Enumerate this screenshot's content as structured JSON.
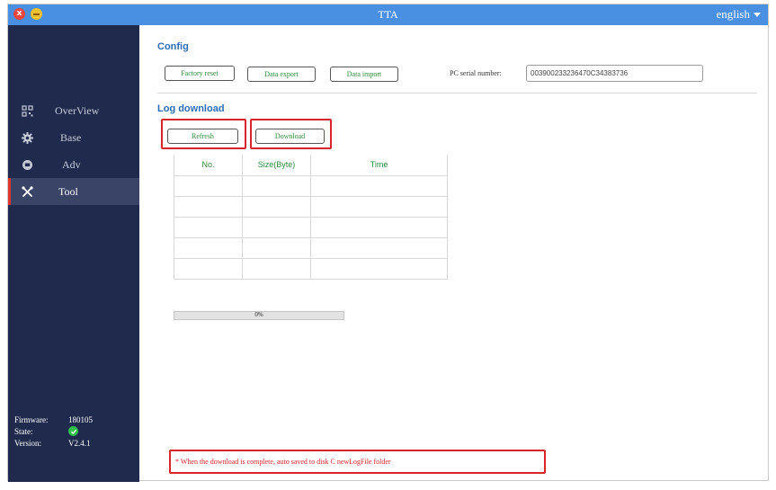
{
  "titlebar": {
    "close_symbol": "x",
    "title": "TTA",
    "language": "english"
  },
  "sidebar": {
    "items": [
      {
        "label": "OverView",
        "icon": "qr-grid-icon",
        "active": false
      },
      {
        "label": "Base",
        "icon": "gear-icon",
        "active": false
      },
      {
        "label": "Adv",
        "icon": "chip-icon",
        "active": false
      },
      {
        "label": "Tool",
        "icon": "tools-icon",
        "active": true
      }
    ],
    "info": {
      "firmware_label": "Firmware:",
      "firmware_value": "180105",
      "state_label": "State:",
      "version_label": "Version:",
      "version_value": "V2.4.1"
    }
  },
  "config": {
    "title": "Config",
    "factory_reset": "Factory reset",
    "data_export": "Data export",
    "data_import": "Data import",
    "serial_label": "PC serial number:",
    "serial_value": "003900233236470C34383736"
  },
  "log_download": {
    "title": "Log download",
    "refresh": "Refresh",
    "download": "Download",
    "columns": [
      "No.",
      "Size(Byte)",
      "Time"
    ],
    "progress_text": "0%",
    "progress_value": 0,
    "note": "* When the download is complete, auto saved to disk C newLogFile folder"
  },
  "colors": {
    "titlebar": "#4a90e2",
    "sidebar": "#1f2a4d",
    "active_item": "#394467",
    "accent_red": "#d8242a",
    "label_green": "#2e8b3a",
    "section_blue": "#2d6cb5"
  }
}
